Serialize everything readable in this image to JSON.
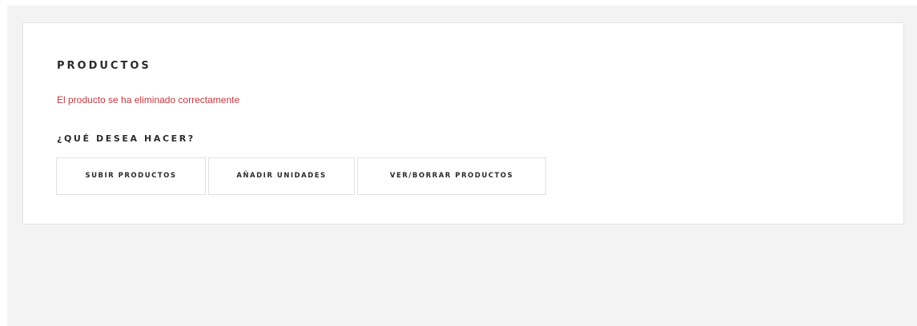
{
  "section": {
    "title": "PRODUCTOS",
    "message": "El producto se ha eliminado correctamente",
    "question": "¿QUÉ DESEA HACER?"
  },
  "actions": {
    "upload_label": "SUBIR PRODUCTOS",
    "add_units_label": "AÑADIR UNIDADES",
    "view_delete_label": "VER/BORRAR PRODUCTOS"
  },
  "colors": {
    "page_background": "#f3f3f3",
    "card_background": "#ffffff",
    "message_color": "#c9363e",
    "text_color": "#2b2b2b"
  }
}
